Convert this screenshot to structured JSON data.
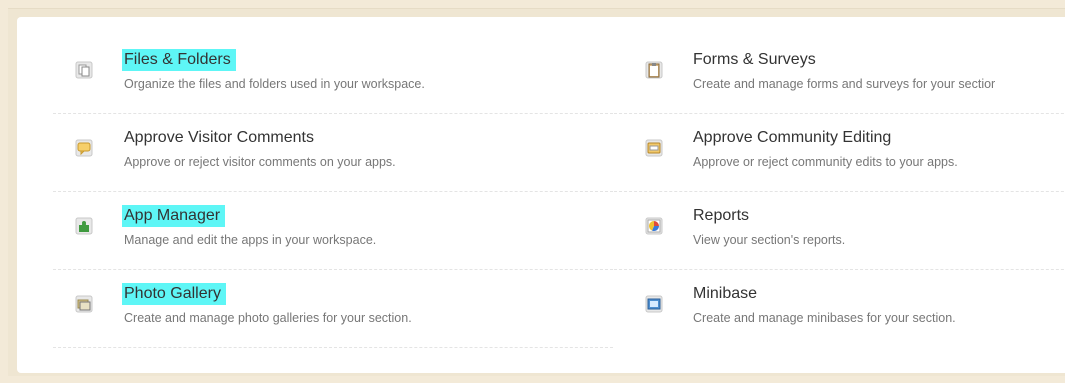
{
  "left_items": [
    {
      "title": "Files & Folders",
      "desc": "Organize the files and folders used in your workspace.",
      "icon": "files-icon",
      "highlighted": true
    },
    {
      "title": "Approve Visitor Comments",
      "desc": "Approve or reject visitor comments on your apps.",
      "icon": "comments-icon",
      "highlighted": false
    },
    {
      "title": "App Manager",
      "desc": "Manage and edit the apps in your workspace.",
      "icon": "puzzle-icon",
      "highlighted": true
    },
    {
      "title": "Photo Gallery",
      "desc": "Create and manage photo galleries for your section.",
      "icon": "photo-gallery-icon",
      "highlighted": true
    }
  ],
  "right_items": [
    {
      "title": "Forms & Surveys",
      "desc": "Create and manage forms and surveys for your sectior",
      "icon": "clipboard-icon",
      "highlighted": false
    },
    {
      "title": "Approve Community Editing",
      "desc": "Approve or reject community edits to your apps.",
      "icon": "community-edit-icon",
      "highlighted": false
    },
    {
      "title": "Reports",
      "desc": "View your section's reports.",
      "icon": "reports-icon",
      "highlighted": false
    },
    {
      "title": "Minibase",
      "desc": "Create and manage minibases for your section.",
      "icon": "minibase-icon",
      "highlighted": false
    }
  ],
  "colors": {
    "highlight": "#5ef6f6",
    "background": "#efe6d2"
  }
}
